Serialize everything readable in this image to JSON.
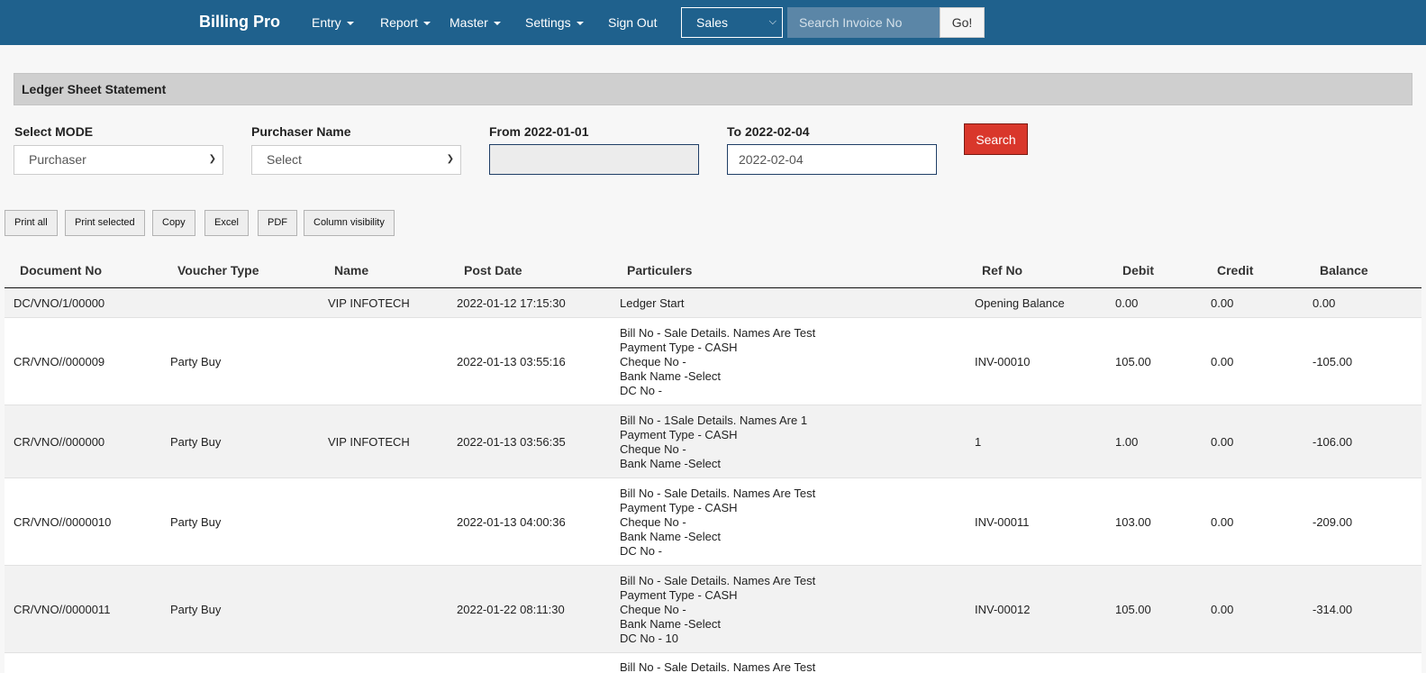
{
  "nav": {
    "brand": "Billing Pro",
    "menu": [
      "Entry",
      "Report",
      "Master",
      "Settings"
    ],
    "signout": "Sign Out",
    "mode_select": "Sales",
    "search_placeholder": "Search Invoice No",
    "go_label": "Go!"
  },
  "page": {
    "title": "Ledger Sheet Statement"
  },
  "filters": {
    "mode_label": "Select MODE",
    "mode_value": "Purchaser",
    "purchaser_label": "Purchaser Name",
    "purchaser_value": "Select",
    "from_label": "From 2022-01-01",
    "from_value": "",
    "to_label": "To 2022-02-04",
    "to_value": "2022-02-04",
    "search_label": "Search"
  },
  "toolbar": [
    "Print all",
    "Print selected",
    "Copy",
    "Excel",
    "PDF",
    "Column visibility"
  ],
  "table": {
    "headers": [
      "Document No",
      "Voucher Type",
      "Name",
      "Post Date",
      "Particulers",
      "Ref No",
      "Debit",
      "Credit",
      "Balance"
    ],
    "rows": [
      {
        "doc": "DC/VNO/1/00000",
        "voucher": "",
        "name": "VIP INFOTECH",
        "date": "2022-01-12 17:15:30",
        "particulars": [
          "Ledger Start"
        ],
        "ref": "Opening Balance",
        "debit": "0.00",
        "credit": "0.00",
        "balance": "0.00"
      },
      {
        "doc": "CR/VNO//000009",
        "voucher": "Party Buy",
        "name": "",
        "date": "2022-01-13 03:55:16",
        "particulars": [
          "Bill No - Sale Details. Names Are Test",
          "Payment Type - CASH",
          "Cheque No -",
          "Bank Name -Select",
          "DC No -"
        ],
        "ref": "INV-00010",
        "debit": "105.00",
        "credit": "0.00",
        "balance": "-105.00"
      },
      {
        "doc": "CR/VNO//000000",
        "voucher": "Party Buy",
        "name": "VIP INFOTECH",
        "date": "2022-01-13 03:56:35",
        "particulars": [
          "Bill No - 1Sale Details. Names Are 1",
          "Payment Type - CASH",
          "Cheque No -",
          "Bank Name -Select"
        ],
        "ref": "1",
        "debit": "1.00",
        "credit": "0.00",
        "balance": "-106.00"
      },
      {
        "doc": "CR/VNO//0000010",
        "voucher": "Party Buy",
        "name": "",
        "date": "2022-01-13 04:00:36",
        "particulars": [
          "Bill No - Sale Details. Names Are Test",
          "Payment Type - CASH",
          "Cheque No -",
          "Bank Name -Select",
          "DC No -"
        ],
        "ref": "INV-00011",
        "debit": "103.00",
        "credit": "0.00",
        "balance": "-209.00"
      },
      {
        "doc": "CR/VNO//0000011",
        "voucher": "Party Buy",
        "name": "",
        "date": "2022-01-22 08:11:30",
        "particulars": [
          "Bill No - Sale Details. Names Are Test",
          "Payment Type - CASH",
          "Cheque No -",
          "Bank Name -Select",
          "DC No - 10"
        ],
        "ref": "INV-00012",
        "debit": "105.00",
        "credit": "0.00",
        "balance": "-314.00"
      },
      {
        "doc": "",
        "voucher": "",
        "name": "",
        "date": "",
        "particulars": [
          "Bill No - Sale Details. Names Are Test"
        ],
        "ref": "",
        "debit": "",
        "credit": "",
        "balance": ""
      }
    ]
  }
}
